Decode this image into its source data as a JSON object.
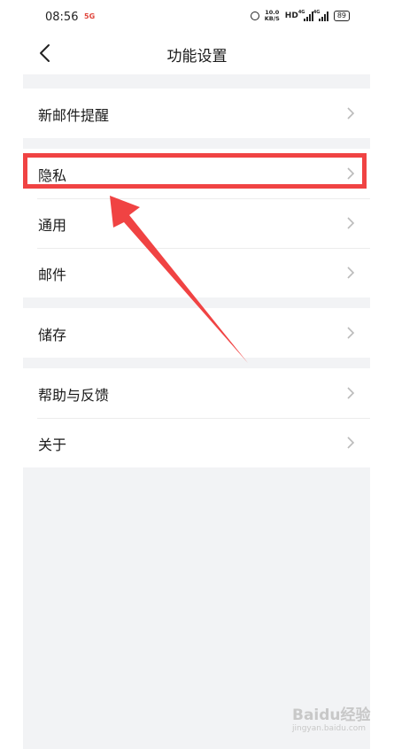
{
  "status_bar": {
    "time": "08:56",
    "network_badge": "5G",
    "speed_value": "10.0",
    "speed_unit": "KB/S",
    "hd_label": "HD",
    "signal1_tag": "4G",
    "signal2_tag": "4G",
    "battery": "89"
  },
  "nav": {
    "title": "功能设置"
  },
  "sections": [
    {
      "items": [
        {
          "label": "新邮件提醒"
        }
      ]
    },
    {
      "items": [
        {
          "label": "隐私"
        },
        {
          "label": "通用"
        },
        {
          "label": "邮件"
        }
      ]
    },
    {
      "items": [
        {
          "label": "储存"
        }
      ]
    },
    {
      "items": [
        {
          "label": "帮助与反馈"
        },
        {
          "label": "关于"
        }
      ]
    }
  ],
  "annotation": {
    "highlighted_item": "隐私",
    "color": "#f04343"
  },
  "watermark": {
    "logo": "Baidu经验",
    "url": "jingyan.baidu.com"
  },
  "colors": {
    "background": "#f2f3f5",
    "row_background": "#ffffff",
    "text": "#1a1a1a",
    "chevron": "#bbbbbb"
  }
}
